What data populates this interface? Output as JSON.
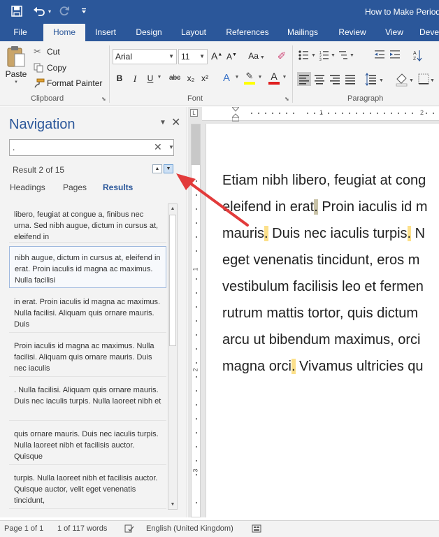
{
  "titlebar": {
    "doc_title": "How to Make Period",
    "icons": [
      "save-icon",
      "undo-icon",
      "undo-dropdown-icon",
      "redo-icon",
      "customize-toolbar-icon"
    ]
  },
  "tabs": [
    {
      "label": "File"
    },
    {
      "label": "Home",
      "active": true
    },
    {
      "label": "Insert"
    },
    {
      "label": "Design"
    },
    {
      "label": "Layout"
    },
    {
      "label": "References"
    },
    {
      "label": "Mailings"
    },
    {
      "label": "Review"
    },
    {
      "label": "View"
    },
    {
      "label": "Deve"
    }
  ],
  "ribbon": {
    "clipboard": {
      "group_label": "Clipboard",
      "paste": "Paste",
      "cut": "Cut",
      "copy": "Copy",
      "format_painter": "Format Painter"
    },
    "font": {
      "group_label": "Font",
      "font_name": "Arial",
      "font_size": "11",
      "change_case": "Aa",
      "bold": "B",
      "italic": "I",
      "underline": "U",
      "strikethrough": "abc",
      "subscript": "x₂",
      "superscript": "x²"
    },
    "paragraph": {
      "group_label": "Paragraph"
    }
  },
  "navigation": {
    "title": "Navigation",
    "search_value": ".",
    "result_count": "Result 2 of 15",
    "tabs": [
      {
        "label": "Headings"
      },
      {
        "label": "Pages"
      },
      {
        "label": "Results",
        "active": true
      }
    ],
    "results": [
      {
        "text": "libero, feugiat at congue a, finibus nec urna. Sed nibh augue, dictum in cursus at, eleifend in"
      },
      {
        "text": "nibh augue, dictum in cursus at, eleifend in erat. Proin iaculis id magna ac maximus. Nulla facilisi",
        "selected": true
      },
      {
        "text": "in erat. Proin iaculis id magna ac maximus. Nulla facilisi. Aliquam quis ornare mauris. Duis"
      },
      {
        "text": "Proin iaculis id magna ac maximus. Nulla facilisi. Aliquam quis ornare mauris. Duis nec iaculis"
      },
      {
        "text": ". Nulla facilisi. Aliquam quis ornare mauris. Duis nec iaculis turpis. Nulla laoreet nibh et"
      },
      {
        "text": "quis ornare mauris. Duis nec iaculis turpis. Nulla laoreet nibh et facilisis auctor. Quisque"
      },
      {
        "text": "turpis. Nulla laoreet nibh et facilisis auctor. Quisque auctor, velit eget venenatis tincidunt,"
      }
    ]
  },
  "ruler": {
    "h_numbers": [
      "1",
      "2"
    ],
    "v_numbers": [
      "1",
      "2",
      "3"
    ]
  },
  "document": {
    "lines": [
      {
        "text": "Etiam nibh libero, feugiat at cong"
      },
      {
        "before": "eleifend in erat",
        "mark": ".",
        "after": " Proin iaculis id m",
        "mark_selected": true
      },
      {
        "before": "mauris",
        "mark": ".",
        "after": " Duis nec iaculis turpis",
        "mark2": ".",
        "after2": " N"
      },
      {
        "text": "eget venenatis tincidunt, eros m"
      },
      {
        "text": "vestibulum facilisis leo et fermen"
      },
      {
        "text": "rutrum mattis tortor, quis dictum"
      },
      {
        "text": "arcu ut bibendum maximus, orci"
      },
      {
        "before": "magna orci",
        "mark": ".",
        "after": " Vivamus ultricies qu"
      }
    ]
  },
  "statusbar": {
    "page": "Page 1 of 1",
    "words": "1 of 117 words",
    "language": "English (United Kingdom)"
  },
  "colors": {
    "accent": "#2b579a",
    "highlight": "#fce08a",
    "annotation_arrow": "#e23b3b"
  }
}
